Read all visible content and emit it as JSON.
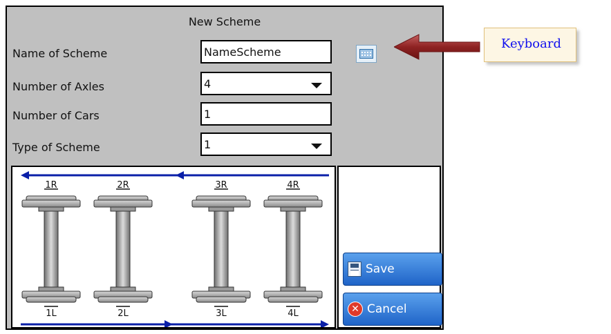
{
  "dialog": {
    "title": "New Scheme",
    "fields": {
      "name_label": "Name of Scheme",
      "name_value": "NameScheme",
      "axles_label": "Number of Axles",
      "axles_value": "4",
      "cars_label": "Number of Cars",
      "cars_value": "1",
      "type_label": "Type of Scheme",
      "type_value": "1"
    },
    "keyboard_icon": "keyboard-icon",
    "save_label": "Save",
    "cancel_label": "Cancel"
  },
  "scheme": {
    "top_labels": [
      "1R",
      "2R",
      "3R",
      "4R"
    ],
    "bottom_labels": [
      "1L",
      "2L",
      "3L",
      "4L"
    ]
  },
  "callout": {
    "text": "Keyboard"
  },
  "colors": {
    "dialog_bg": "#c0c0c0",
    "button_blue": "#2f78d8",
    "arrow_blue": "#0a1fa8",
    "callout_arrow": "#8e2222",
    "callout_text": "#1010ee"
  }
}
